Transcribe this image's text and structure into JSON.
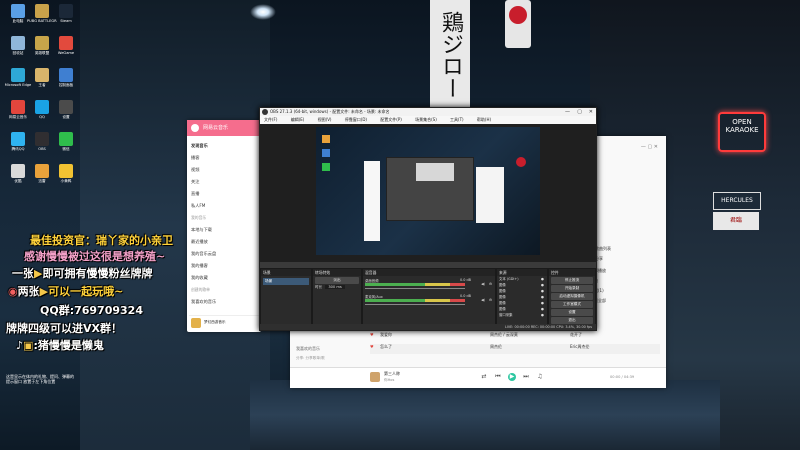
{
  "desktop": {
    "icons": [
      {
        "label": "此电脑",
        "icon": "computer-icon",
        "color": "#5aa0e6"
      },
      {
        "label": "PUBG BATTLEGR...",
        "icon": "pubg-icon",
        "color": "#c9a24a"
      },
      {
        "label": "Steam",
        "icon": "steam-icon",
        "color": "#1b2838"
      },
      {
        "label": "回收站",
        "icon": "recycle-bin-icon",
        "color": "#8fb6d9"
      },
      {
        "label": "英雄联盟",
        "icon": "lol-icon",
        "color": "#c7a54a"
      },
      {
        "label": "WeGame",
        "icon": "wegame-icon",
        "color": "#e24a3d"
      },
      {
        "label": "Microsoft Edge",
        "icon": "edge-icon",
        "color": "#2ea8d6"
      },
      {
        "label": "王者",
        "icon": "game-icon",
        "color": "#d9b56b"
      },
      {
        "label": "控制面板",
        "icon": "control-panel-icon",
        "color": "#3f7fd1"
      },
      {
        "label": "网易云音乐",
        "icon": "music-icon",
        "color": "#e2463d"
      },
      {
        "label": "QQ",
        "icon": "qq-icon",
        "color": "#1aa3e5"
      },
      {
        "label": "设置",
        "icon": "settings-icon",
        "color": "#4b4b4b"
      },
      {
        "label": "腾讯QQ",
        "icon": "tencent-qq-icon",
        "color": "#2fb3f0"
      },
      {
        "label": "OBS",
        "icon": "obs-icon",
        "color": "#302e31"
      },
      {
        "label": "微信",
        "icon": "wechat-icon",
        "color": "#2fbd4c"
      },
      {
        "label": "优酷",
        "icon": "video-icon",
        "color": "#d9d9d9"
      },
      {
        "label": "迅雷",
        "icon": "thunder-icon",
        "color": "#e9a23b"
      },
      {
        "label": "小黄鸭",
        "icon": "duck-icon",
        "color": "#f1c232"
      }
    ]
  },
  "overlay": {
    "line1": "最佳投资官：瑞丫家的小亲卫",
    "line2": "感谢慢慢被过这很是想养殖~",
    "line3a": "一张",
    "line3b": "即可拥有慢慢粉丝牌牌",
    "line4a": "两张",
    "line4b": "可以一起玩哦~",
    "line5": "QQ群:769709324",
    "line6": "牌牌四级可以进VX群！",
    "line7": ":猪慢慢是懒鬼"
  },
  "music_app": {
    "title": "网易云音乐",
    "nav": [
      "发现音乐",
      "播客",
      "视频",
      "关注",
      "直播",
      "私人FM"
    ],
    "section_mine": "我的音乐",
    "mine": [
      "本地与下载",
      "最近播放",
      "我的音乐云盘",
      "我的播客",
      "我的收藏"
    ],
    "section_created": "创建的歌单",
    "created": [
      "我喜欢的音乐"
    ],
    "now_playing": "梦幻西游音乐"
  },
  "obs": {
    "title": "OBS 27.1.3 (64-bit, windows) - 配置文件: 未命名 - 场景: 未命名",
    "menu": [
      "文件(F)",
      "编辑(E)",
      "视图(V)",
      "停靠窗口(D)",
      "配置文件(P)",
      "场景集合(S)",
      "工具(T)",
      "帮助(H)"
    ],
    "docks": {
      "scenes": "场景",
      "sources": "来源",
      "mixer": "混音器",
      "transitions": "转场特效",
      "controls": "控件"
    },
    "scene_item": "场景",
    "transition_value": "淡出",
    "duration_label": "时长",
    "duration_value": "300 ms",
    "mixer_tracks": [
      {
        "name": "桌面音频",
        "level": "0.0 dB"
      },
      {
        "name": "麦克风/Aux",
        "level": "0.0 dB"
      }
    ],
    "sources": [
      "文本 (GDI+)",
      "图像",
      "图像",
      "图像",
      "图像",
      "图像",
      "窗口采集"
    ],
    "controls": [
      "停止推流",
      "开始录制",
      "启动虚拟摄像机",
      "工作室模式",
      "设置",
      "退出"
    ],
    "status": "LIVE: 00:00:00   REC: 00:00:00   CPU: 3.4%, 30.00 fps"
  },
  "player": {
    "rows": [
      {
        "title": "我爱你",
        "artist": "周杰伦 / 云深莫",
        "album": "花开了",
        "time": ""
      },
      {
        "title": "怎么了",
        "artist": "周杰伦",
        "album": "Eric周杰伦",
        "time": ""
      },
      {
        "title": "",
        "artist": "",
        "album": "",
        "time": ""
      }
    ],
    "track_title": "第三人称",
    "track_artist": "你Hos",
    "time": "00:00 / 04:39",
    "list_label": "我喜欢的音乐",
    "sub_label": "分享: 分享歌单/歌",
    "right_items": [
      "分享",
      "全部播放",
      "歌曲",
      "收藏(1)",
      "下载全部"
    ],
    "side_note": "歌曲列表"
  },
  "bottom_note": {
    "line1": "这是显示在体内的礼物、提问、弹幕的",
    "line2": "提示窗口 放置于左下角位置"
  }
}
